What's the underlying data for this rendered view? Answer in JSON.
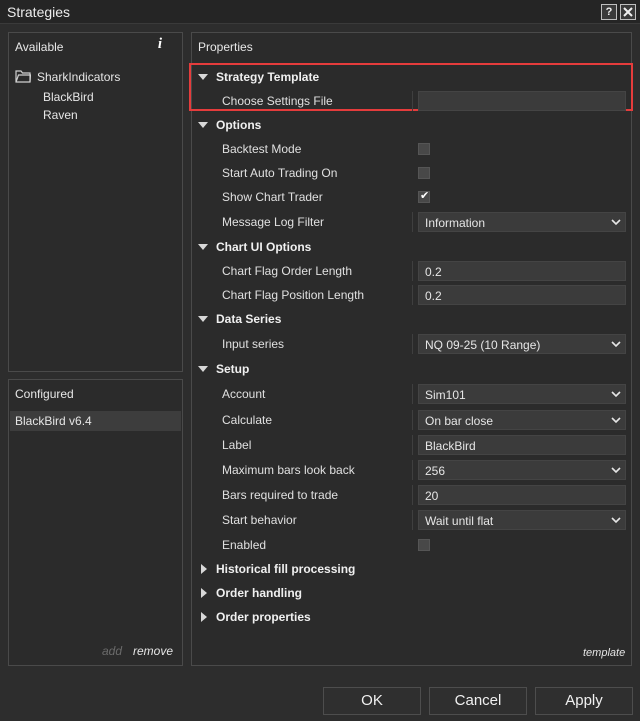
{
  "window": {
    "title": "Strategies",
    "help_label": "?",
    "close_label": "X"
  },
  "available": {
    "header": "Available",
    "info_label": "i",
    "folder": "SharkIndicators",
    "items": [
      "BlackBird",
      "Raven"
    ]
  },
  "configured": {
    "header": "Configured",
    "items": [
      "BlackBird v6.4"
    ],
    "add_label": "add",
    "remove_label": "remove"
  },
  "properties": {
    "header": "Properties",
    "template_label": "template",
    "strategy_template": {
      "label": "Strategy Template",
      "choose_settings_file": "Choose Settings File",
      "value": ""
    },
    "options": {
      "label": "Options",
      "backtest_mode": "Backtest Mode",
      "backtest_checked": false,
      "start_auto_trading": "Start Auto Trading On",
      "start_auto_checked": false,
      "show_chart_trader": "Show Chart Trader",
      "show_chart_checked": true,
      "message_log_filter": "Message Log Filter",
      "message_log_value": "Information"
    },
    "chart_ui": {
      "label": "Chart UI Options",
      "flag_order_length": "Chart Flag Order Length",
      "flag_order_value": "0.2",
      "flag_position_length": "Chart Flag Position Length",
      "flag_position_value": "0.2"
    },
    "data_series": {
      "label": "Data Series",
      "input_series": "Input series",
      "input_series_value": "NQ 09-25 (10 Range)"
    },
    "setup": {
      "label": "Setup",
      "account": "Account",
      "account_value": "Sim101",
      "calculate": "Calculate",
      "calculate_value": "On bar close",
      "label_field": "Label",
      "label_value": "BlackBird",
      "max_bars": "Maximum bars look back",
      "max_bars_value": "256",
      "bars_required": "Bars required to trade",
      "bars_required_value": "20",
      "start_behavior": "Start behavior",
      "start_behavior_value": "Wait until flat",
      "enabled": "Enabled",
      "enabled_checked": false
    },
    "historical_fill": "Historical fill processing",
    "order_handling": "Order handling",
    "order_properties": "Order properties"
  },
  "buttons": {
    "ok": "OK",
    "cancel": "Cancel",
    "apply": "Apply"
  },
  "colors": {
    "background": "#2d2d2d",
    "highlight": "#e53c3c",
    "field": "#3b3b3b"
  }
}
